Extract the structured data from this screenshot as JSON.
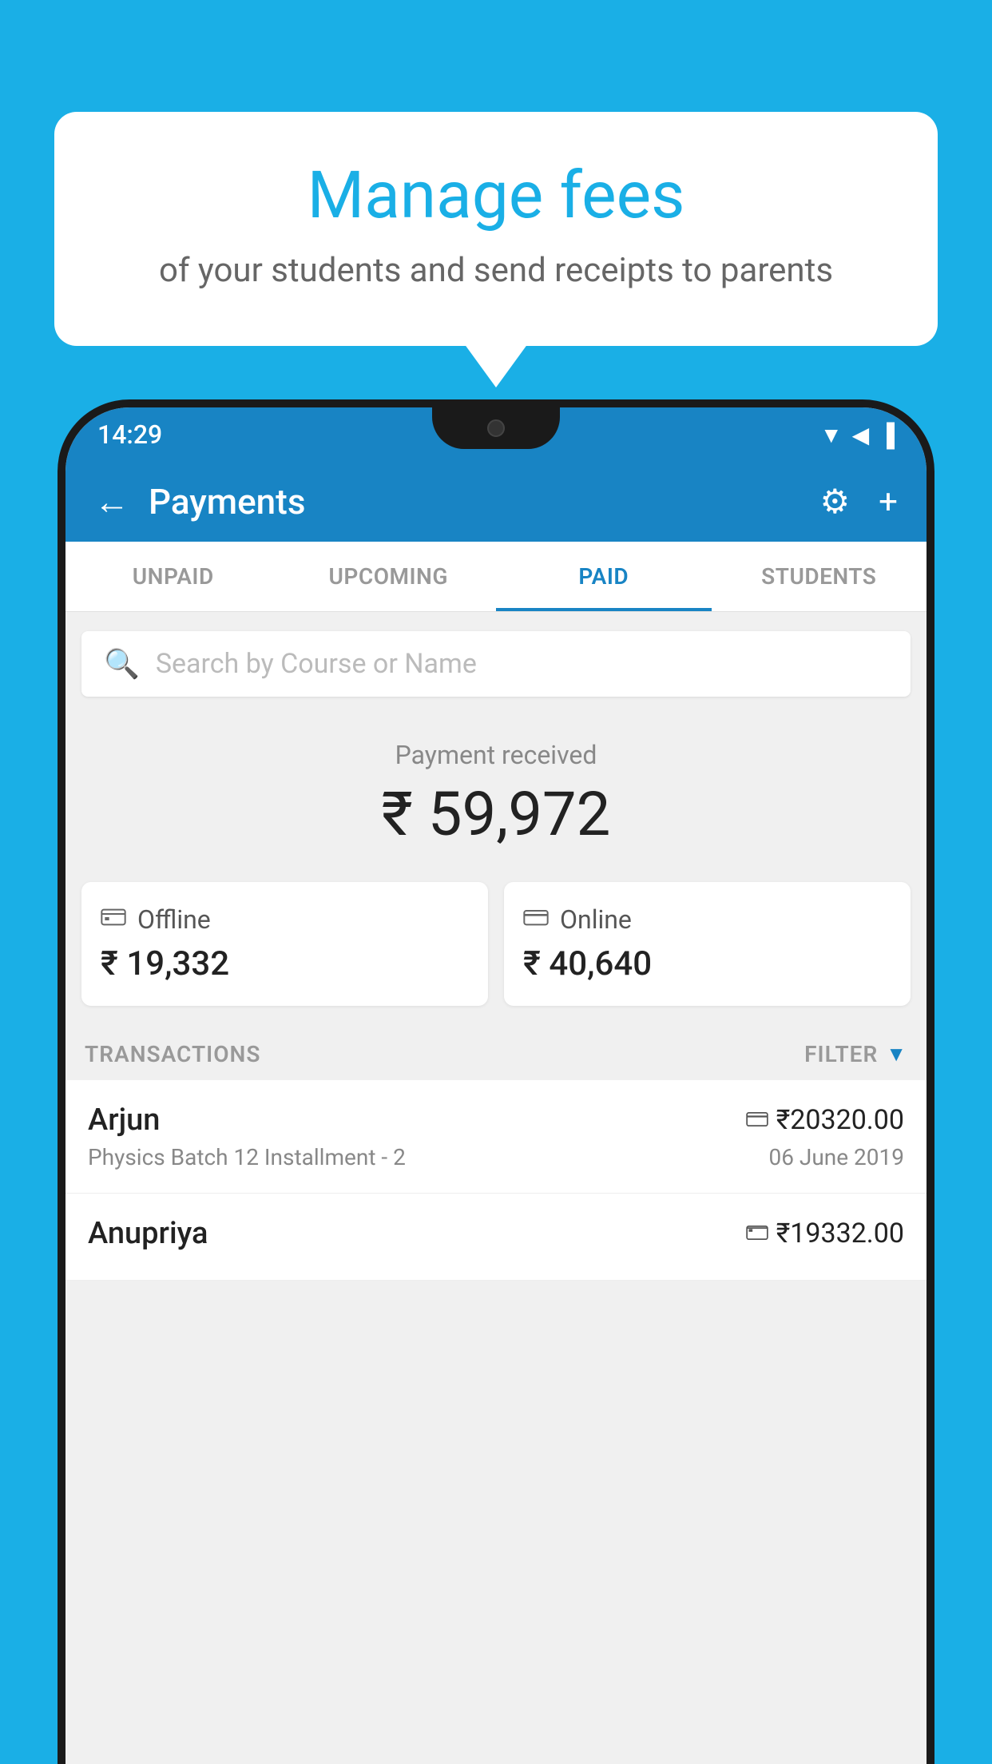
{
  "background_color": "#1AAFE6",
  "bubble": {
    "title": "Manage fees",
    "subtitle": "of your students and send receipts to parents"
  },
  "status_bar": {
    "time": "14:29",
    "wifi": "▲",
    "signal": "▲",
    "battery": "▐"
  },
  "app_bar": {
    "title": "Payments",
    "back_label": "←",
    "gear_label": "⚙",
    "plus_label": "+"
  },
  "tabs": [
    {
      "label": "UNPAID",
      "active": false
    },
    {
      "label": "UPCOMING",
      "active": false
    },
    {
      "label": "PAID",
      "active": true
    },
    {
      "label": "STUDENTS",
      "active": false
    }
  ],
  "search": {
    "placeholder": "Search by Course or Name"
  },
  "payment_received": {
    "label": "Payment received",
    "amount": "₹ 59,972"
  },
  "payment_cards": [
    {
      "type": "Offline",
      "amount": "₹ 19,332",
      "icon": "💳"
    },
    {
      "type": "Online",
      "amount": "₹ 40,640",
      "icon": "💳"
    }
  ],
  "transactions_label": "TRANSACTIONS",
  "filter_label": "FILTER",
  "transactions": [
    {
      "name": "Arjun",
      "course": "Physics Batch 12 Installment - 2",
      "amount": "₹20320.00",
      "date": "06 June 2019",
      "payment_type": "online"
    },
    {
      "name": "Anupriya",
      "course": "",
      "amount": "₹19332.00",
      "date": "",
      "payment_type": "offline"
    }
  ]
}
